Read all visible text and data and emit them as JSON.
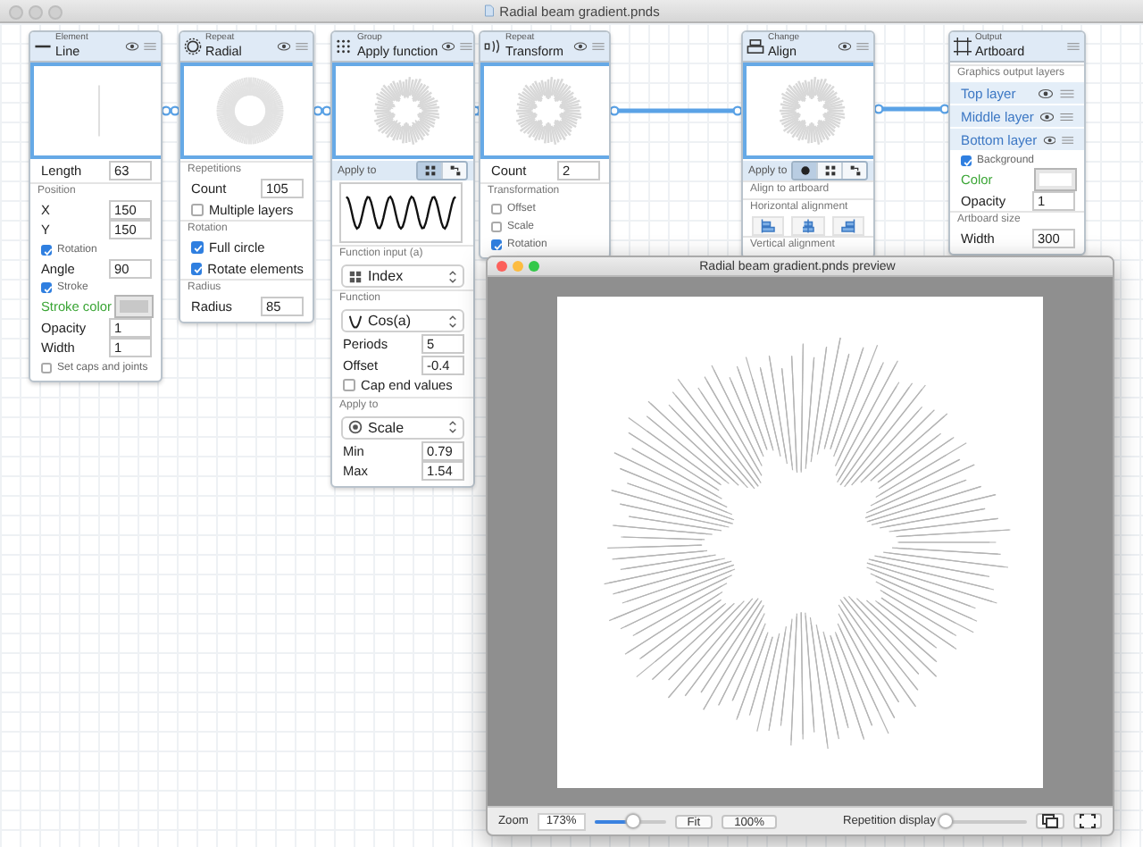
{
  "window": {
    "title": "Radial beam gradient.pnds"
  },
  "nodes": [
    {
      "kind": "line",
      "category": "Element",
      "name": "Line",
      "rows": [
        {
          "kind": "number",
          "label": "Length",
          "value": "63"
        },
        {
          "kind": "section",
          "label": "Position"
        },
        {
          "kind": "number",
          "label": "X",
          "value": "150"
        },
        {
          "kind": "number",
          "label": "Y",
          "value": "150"
        },
        {
          "kind": "subcheck",
          "label": "Rotation",
          "checked": true
        },
        {
          "kind": "number",
          "label": "Angle",
          "value": "90"
        },
        {
          "kind": "subcheck",
          "label": "Stroke",
          "checked": true
        },
        {
          "kind": "color",
          "label": "Stroke color",
          "color": "#c8c8c8"
        },
        {
          "kind": "number",
          "label": "Opacity",
          "value": "1"
        },
        {
          "kind": "number",
          "label": "Width",
          "value": "1"
        },
        {
          "kind": "subcheck",
          "label": "Set caps and joints",
          "checked": false
        }
      ]
    },
    {
      "kind": "radial",
      "category": "Repeat",
      "name": "Radial",
      "rows": [
        {
          "kind": "section",
          "label": "Repetitions"
        },
        {
          "kind": "number",
          "label": "Count",
          "value": "105"
        },
        {
          "kind": "check",
          "label": "Multiple layers",
          "checked": false
        },
        {
          "kind": "section",
          "label": "Rotation"
        },
        {
          "kind": "check",
          "label": "Full circle",
          "checked": true
        },
        {
          "kind": "check",
          "label": "Rotate elements",
          "checked": true
        },
        {
          "kind": "section",
          "label": "Radius"
        },
        {
          "kind": "number",
          "label": "Radius",
          "value": "85"
        }
      ]
    },
    {
      "kind": "function",
      "category": "Group",
      "name": "Apply function",
      "rows": [
        {
          "kind": "applyto",
          "label": "Apply to",
          "segments": [
            {
              "selected": true
            },
            {
              "selected": false
            }
          ]
        },
        {
          "kind": "wave"
        },
        {
          "kind": "section",
          "label": "Function input (a)"
        },
        {
          "kind": "select",
          "value": "Index"
        },
        {
          "kind": "section",
          "label": "Function"
        },
        {
          "kind": "select",
          "value": "Cos(a)"
        },
        {
          "kind": "number",
          "label": "Periods",
          "value": "5"
        },
        {
          "kind": "number",
          "label": "Offset",
          "value": "-0.4"
        },
        {
          "kind": "check",
          "label": "Cap end values",
          "checked": false
        },
        {
          "kind": "section",
          "label": "Apply to"
        },
        {
          "kind": "select",
          "value": "Scale"
        },
        {
          "kind": "number",
          "label": "Min",
          "value": "0.79"
        },
        {
          "kind": "number",
          "label": "Max",
          "value": "1.54"
        }
      ]
    },
    {
      "kind": "transform",
      "category": "Repeat",
      "name": "Transform",
      "rows": [
        {
          "kind": "number",
          "label": "Count",
          "value": "2"
        },
        {
          "kind": "section",
          "label": "Transformation"
        },
        {
          "kind": "subcheck",
          "label": "Offset",
          "checked": false
        },
        {
          "kind": "subcheck",
          "label": "Scale",
          "checked": false
        },
        {
          "kind": "subcheck",
          "label": "Rotation",
          "checked": true
        }
      ]
    },
    {
      "kind": "align",
      "category": "Change",
      "name": "Align",
      "rows": [
        {
          "kind": "applyto",
          "label": "Apply to",
          "segments": [
            {
              "selected": true
            },
            {
              "selected": false
            },
            {
              "selected": false
            }
          ]
        },
        {
          "kind": "section",
          "label": "Align to artboard"
        },
        {
          "kind": "section",
          "label": "Horizontal alignment"
        },
        {
          "kind": "align"
        },
        {
          "kind": "section",
          "label": "Vertical alignment"
        }
      ]
    },
    {
      "kind": "artboard",
      "category": "Output",
      "name": "Artboard",
      "rows": [
        {
          "kind": "section",
          "label": "Graphics output layers"
        },
        {
          "kind": "layer",
          "label": "Top layer"
        },
        {
          "kind": "layer",
          "label": "Middle layer"
        },
        {
          "kind": "layer",
          "label": "Bottom layer"
        },
        {
          "kind": "subcheck",
          "label": "Background",
          "checked": true
        },
        {
          "kind": "color",
          "label": "Color",
          "color": "#ffffff"
        },
        {
          "kind": "number",
          "label": "Opacity",
          "value": "1"
        },
        {
          "kind": "section",
          "label": "Artboard size"
        },
        {
          "kind": "number",
          "label": "Width",
          "value": "300"
        }
      ]
    }
  ],
  "preview": {
    "title": "Radial beam gradient.pnds preview",
    "zoom_label": "Zoom",
    "zoom_value": "173%",
    "zoom_slider": {
      "level": 0.55
    },
    "fit_button": "Fit",
    "actual_size_button": "100%",
    "repetition_label": "Repetition display",
    "repetition_slider": {
      "level": 0
    }
  }
}
